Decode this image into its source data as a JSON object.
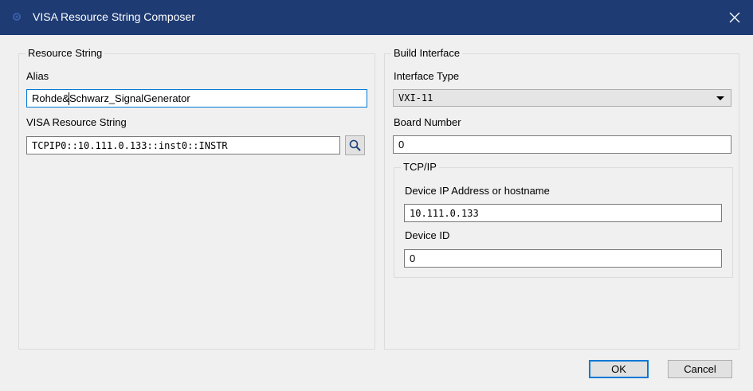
{
  "window": {
    "title": "VISA Resource String Composer"
  },
  "resource_group": {
    "title": "Resource String",
    "alias_label": "Alias",
    "alias_value": "Rohde&Schwarz_SignalGenerator",
    "visa_label": "VISA Resource String",
    "visa_value": "TCPIP0::10.111.0.133::inst0::INSTR"
  },
  "build_group": {
    "title": "Build Interface",
    "interface_type_label": "Interface Type",
    "interface_type_value": "VXI-11",
    "board_number_label": "Board Number",
    "board_number_value": "0",
    "tcpip": {
      "title": "TCP/IP",
      "ip_label": "Device IP Address or hostname",
      "ip_value": "10.111.0.133",
      "device_id_label": "Device ID",
      "device_id_value": "0"
    }
  },
  "buttons": {
    "ok": "OK",
    "cancel": "Cancel"
  },
  "colors": {
    "titlebar": "#1e3b74",
    "focus": "#0078d7",
    "background": "#f0f0f0"
  }
}
